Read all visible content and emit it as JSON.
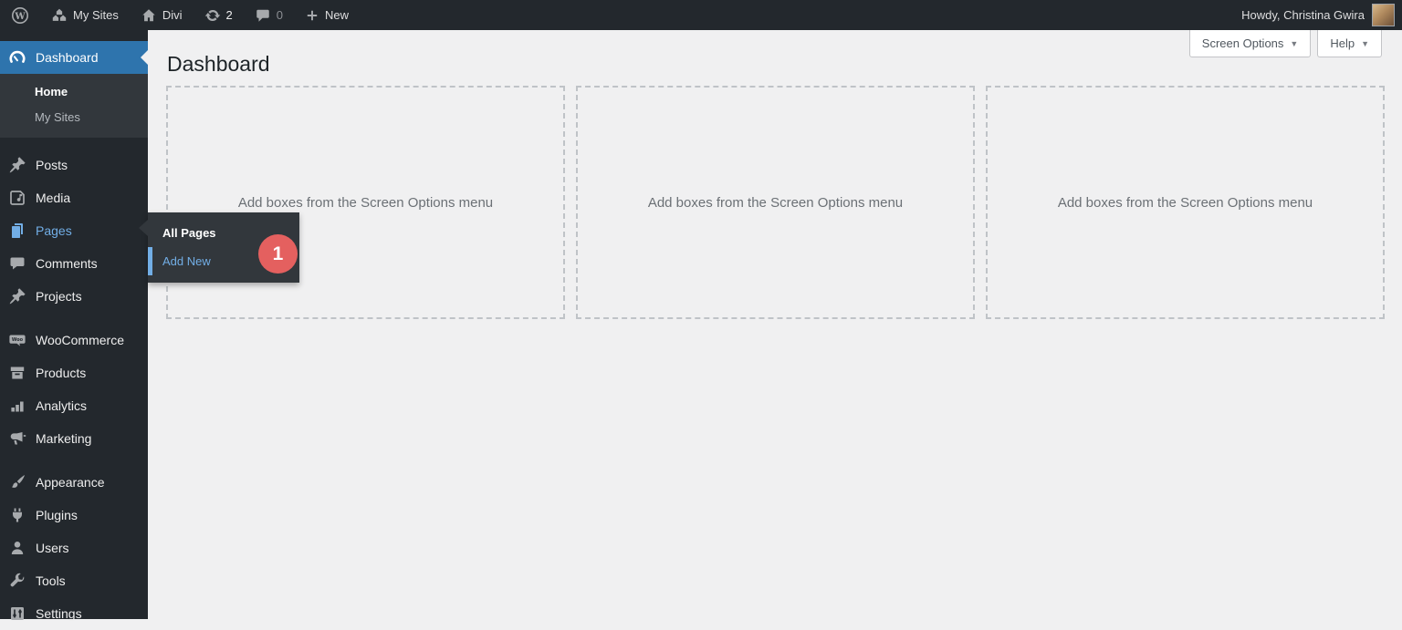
{
  "admin_bar": {
    "my_sites_label": "My Sites",
    "site_name": "Divi",
    "update_count": "2",
    "comment_count": "0",
    "new_label": "New",
    "howdy": "Howdy, Christina Gwira"
  },
  "screen_meta": {
    "screen_options_label": "Screen Options",
    "help_label": "Help",
    "caret": "▼"
  },
  "page": {
    "title": "Dashboard",
    "empty_box_text": "Add boxes from the Screen Options menu"
  },
  "sidebar": {
    "dashboard_label": "Dashboard",
    "dashboard_submenu": [
      "Home",
      "My Sites"
    ],
    "items": [
      "Posts",
      "Media",
      "Pages",
      "Comments",
      "Projects",
      "WooCommerce",
      "Products",
      "Analytics",
      "Marketing",
      "Appearance",
      "Plugins",
      "Users",
      "Tools",
      "Settings"
    ]
  },
  "pages_flyout": {
    "items": [
      "All Pages",
      "Add New"
    ],
    "badge": "1"
  },
  "colors": {
    "admin_dark": "#23282d",
    "submenu_dark": "#32373c",
    "active_blue": "#2e74ad",
    "link_blue": "#72aee6",
    "badge_red": "#e4605f",
    "content_bg": "#f0f0f1"
  }
}
